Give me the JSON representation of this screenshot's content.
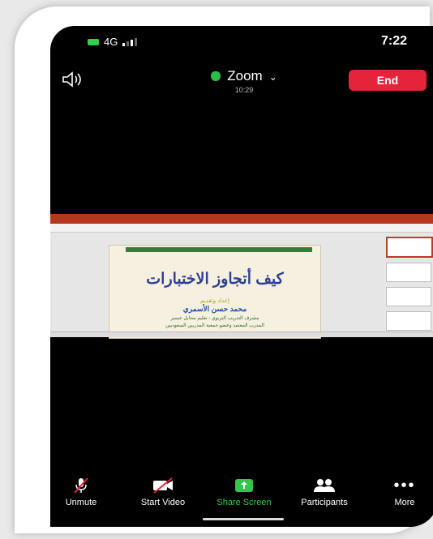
{
  "status": {
    "network": "4G",
    "time": "7:22"
  },
  "meeting": {
    "app_name": "Zoom",
    "duration": "10:29",
    "end_label": "End"
  },
  "shared_slide": {
    "title": "كيف أتجاوز الاختبارات",
    "presenter_prefix": "إعداد وتقديم",
    "presenter_name": "محمد حسن الأسمري",
    "line1": "مشرف التدريب التربوي - تعليم محايل عسير",
    "line2": "المدرب المعتمد وعضو جمعية المدربين السعوديين"
  },
  "toolbar": {
    "unmute": "Unmute",
    "start_video": "Start Video",
    "share_screen": "Share Screen",
    "participants": "Participants",
    "more": "More"
  },
  "colors": {
    "end": "#e5243b",
    "share": "#33c64a",
    "shield": "#2bbf4a"
  }
}
